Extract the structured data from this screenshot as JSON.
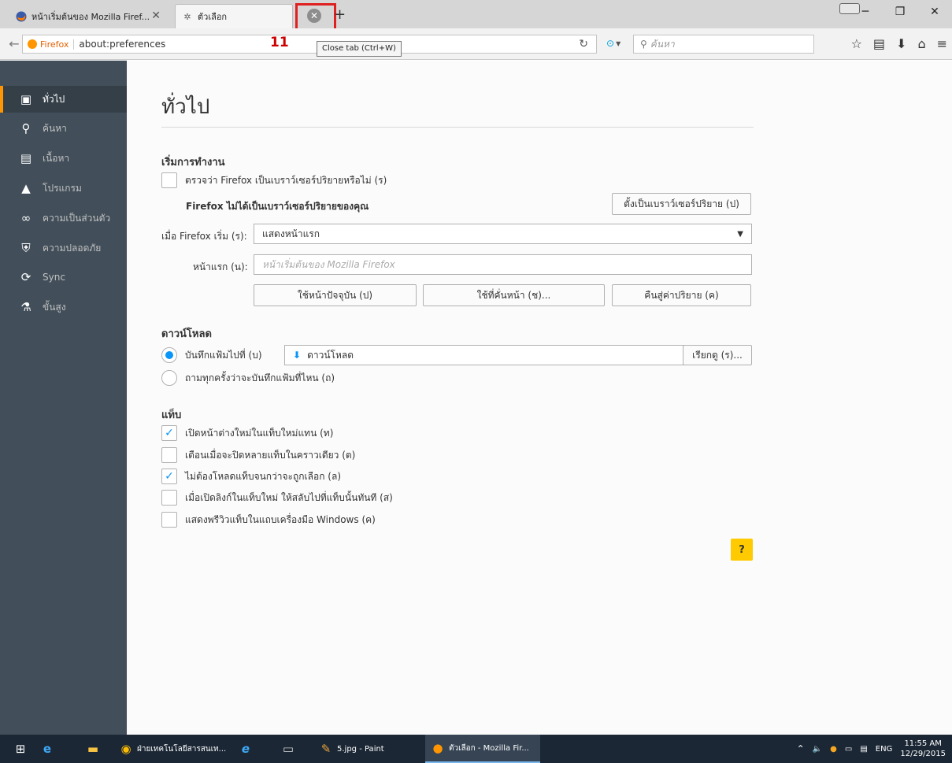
{
  "tabs": [
    {
      "label": "หน้าเริ่มต้นของ Mozilla Firef...",
      "icon": "firefox-icon"
    },
    {
      "label": "ตัวเลือก",
      "icon": "gear-icon"
    }
  ],
  "tooltip": "Close tab (Ctrl+W)",
  "step_label": "11",
  "nav": {
    "identity_label": "Firefox",
    "url": "about:preferences",
    "search_placeholder": "ค้นหา"
  },
  "sidebar": {
    "items": [
      {
        "label": "ทั่วไป",
        "icon": "general-icon",
        "selected": true
      },
      {
        "label": "ค้นหา",
        "icon": "search-icon"
      },
      {
        "label": "เนื้อหา",
        "icon": "content-icon"
      },
      {
        "label": "โปรแกรม",
        "icon": "applications-icon"
      },
      {
        "label": "ความเป็นส่วนตัว",
        "icon": "privacy-mask-icon"
      },
      {
        "label": "ความปลอดภัย",
        "icon": "security-icon"
      },
      {
        "label": "Sync",
        "icon": "sync-icon"
      },
      {
        "label": "ขั้นสูง",
        "icon": "advanced-icon"
      }
    ]
  },
  "page": {
    "title": "ทั่วไป",
    "startup": {
      "heading": "เริ่มการทำงาน",
      "check_default": "ตรวจว่า Firefox เป็นเบราว์เซอร์ปริยายหรือไม่ (ร)",
      "not_default_bold": "Firefox",
      "not_default_rest": " ไม่ได้เป็นเบราว์เซอร์ปริยายของคุณ",
      "make_default_button": "ตั้งเป็นเบราว์เซอร์ปริยาย (ป)",
      "when_starts_label": "เมื่อ Firefox เริ่ม (ร):",
      "when_starts_value": "แสดงหน้าแรก",
      "homepage_label": "หน้าแรก (น):",
      "homepage_placeholder": "หน้าเริ่มต้นของ Mozilla Firefox",
      "use_current_button": "ใช้หน้าปัจจุบัน (ป)",
      "use_bookmark_button": "ใช้ที่คั่นหน้า (ช)...",
      "restore_default_button": "คืนสู่ค่าปริยาย (ค)"
    },
    "downloads": {
      "heading": "ดาวน์โหลด",
      "save_to_label": "บันทึกแฟ้มไปที่ (บ)",
      "save_to_folder": "ดาวน์โหลด",
      "browse_button": "เรียกดู (ร)...",
      "always_ask_label": "ถามทุกครั้งว่าจะบันทึกแฟ้มที่ไหน (ถ)",
      "save_to_selected": true
    },
    "tabs": {
      "heading": "แท็บ",
      "options": [
        {
          "label": "เปิดหน้าต่างใหม่ในแท็บใหม่แทน (ท)",
          "checked": true
        },
        {
          "label": "เตือนเมื่อจะปิดหลายแท็บในคราวเดียว (ต)",
          "checked": false
        },
        {
          "label": "ไม่ต้องโหลดแท็บจนกว่าจะถูกเลือก (ล)",
          "checked": true
        },
        {
          "label": "เมื่อเปิดลิงก์ในแท็บใหม่ ให้สลับไปที่แท็บนั้นทันที (ส)",
          "checked": false
        },
        {
          "label": "แสดงพรีวิวแท็บในแถบเครื่องมือ Windows (ค)",
          "checked": false
        }
      ]
    },
    "help_button": "?"
  },
  "taskbar": {
    "items": [
      {
        "label": "ฝ่ายเทคโนโลยีสารสนเท...",
        "icon": "chrome-icon"
      },
      {
        "label": "5.jpg - Paint",
        "icon": "paint-icon"
      },
      {
        "label": "ตัวเลือก - Mozilla Fir...",
        "icon": "firefox-icon",
        "active": true
      }
    ],
    "language": "ENG",
    "time": "11:55 AM",
    "date": "12/29/2015"
  },
  "colors": {
    "sidebar_bg": "#424f5a",
    "accent": "#ff9500",
    "highlight": "#e02020",
    "checkbox_blue": "#0996f8",
    "help_yellow": "#ffcb00"
  }
}
